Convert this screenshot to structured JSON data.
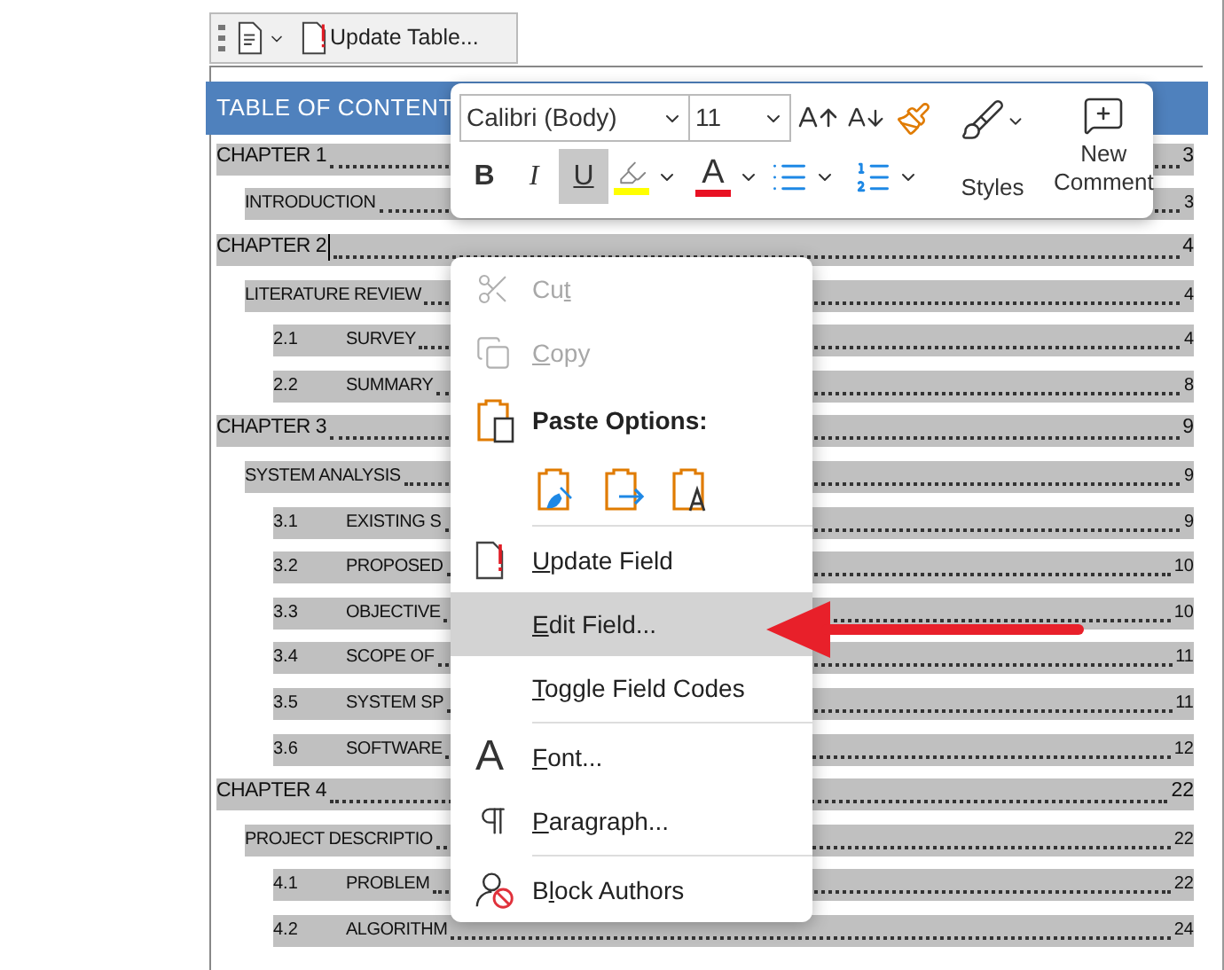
{
  "top_toolbar": {
    "update_button": "Update Table..."
  },
  "heading": "TABLE OF CONTENT",
  "toc": [
    {
      "kind": "chapter",
      "title": "CHAPTER 1",
      "page": "3",
      "cursor": false
    },
    {
      "kind": "section",
      "title": "INTRODUCTION",
      "page": "3",
      "cursor": false
    },
    {
      "kind": "chapter",
      "title": "CHAPTER 2",
      "page": "4",
      "cursor": true
    },
    {
      "kind": "section",
      "title": "LITERATURE REVIEW",
      "page": "4",
      "cursor": false
    },
    {
      "kind": "subsection",
      "number": "2.1",
      "title": "SURVEY",
      "page": "4",
      "cursor": false
    },
    {
      "kind": "subsection",
      "number": "2.2",
      "title": "SUMMARY",
      "page": "8",
      "cursor": false
    },
    {
      "kind": "chapter",
      "title": "CHAPTER 3",
      "page": "9",
      "cursor": false
    },
    {
      "kind": "section",
      "title": "SYSTEM ANALYSIS",
      "page": "9",
      "cursor": false
    },
    {
      "kind": "subsection",
      "number": "3.1",
      "title": "EXISTING S",
      "page": "9",
      "cursor": false
    },
    {
      "kind": "subsection",
      "number": "3.2",
      "title": "PROPOSED",
      "page": "10",
      "cursor": false
    },
    {
      "kind": "subsection",
      "number": "3.3",
      "title": "OBJECTIVE",
      "page": "10",
      "cursor": false
    },
    {
      "kind": "subsection",
      "number": "3.4",
      "title": "SCOPE OF",
      "page": "11",
      "cursor": false
    },
    {
      "kind": "subsection",
      "number": "3.5",
      "title": "SYSTEM SP",
      "page": "11",
      "cursor": false
    },
    {
      "kind": "subsection",
      "number": "3.6",
      "title": "SOFTWARE",
      "page": "12",
      "cursor": false
    },
    {
      "kind": "chapter",
      "title": "CHAPTER 4",
      "page": "22",
      "cursor": false
    },
    {
      "kind": "section",
      "title": "PROJECT DESCRIPTIO",
      "page": "22",
      "cursor": false
    },
    {
      "kind": "subsection",
      "number": "4.1",
      "title": "PROBLEM",
      "page": "22",
      "cursor": false
    },
    {
      "kind": "subsection",
      "number": "4.2",
      "title": "ALGORITHM",
      "page": "24",
      "cursor": false
    }
  ],
  "mini_toolbar": {
    "font": "Calibri (Body)",
    "size": "11",
    "format_buttons": [
      {
        "label": "B",
        "selected": false
      },
      {
        "label": "I",
        "selected": false
      },
      {
        "label": "U",
        "selected": true
      }
    ],
    "font_color_glyph": "A",
    "styles_label": "Styles",
    "comment_label": "New Comment"
  },
  "context_menu": {
    "groups": [
      [
        {
          "kind": "item",
          "before": "Cu",
          "key": "t",
          "disabled": true,
          "selected": false
        },
        {
          "kind": "item",
          "key": "C",
          "after": "opy",
          "disabled": true,
          "selected": false
        },
        {
          "kind": "header",
          "label": "Paste Options:"
        },
        {
          "kind": "paste-icons"
        }
      ],
      [
        {
          "kind": "item",
          "key": "U",
          "after": "pdate Field",
          "disabled": false,
          "selected": false
        },
        {
          "kind": "item",
          "key": "E",
          "after": "dit Field...",
          "disabled": false,
          "selected": true
        },
        {
          "kind": "item",
          "key": "T",
          "after": "oggle Field Codes",
          "disabled": false,
          "selected": false
        }
      ],
      [
        {
          "kind": "item",
          "glyph": "A",
          "key": "F",
          "after": "ont...",
          "disabled": false,
          "selected": false
        },
        {
          "kind": "item",
          "key": "P",
          "after": "aragraph...",
          "disabled": false,
          "selected": false
        }
      ],
      [
        {
          "kind": "item",
          "before": "B",
          "key": "l",
          "after": "ock Authors",
          "disabled": false,
          "selected": false
        }
      ]
    ]
  }
}
